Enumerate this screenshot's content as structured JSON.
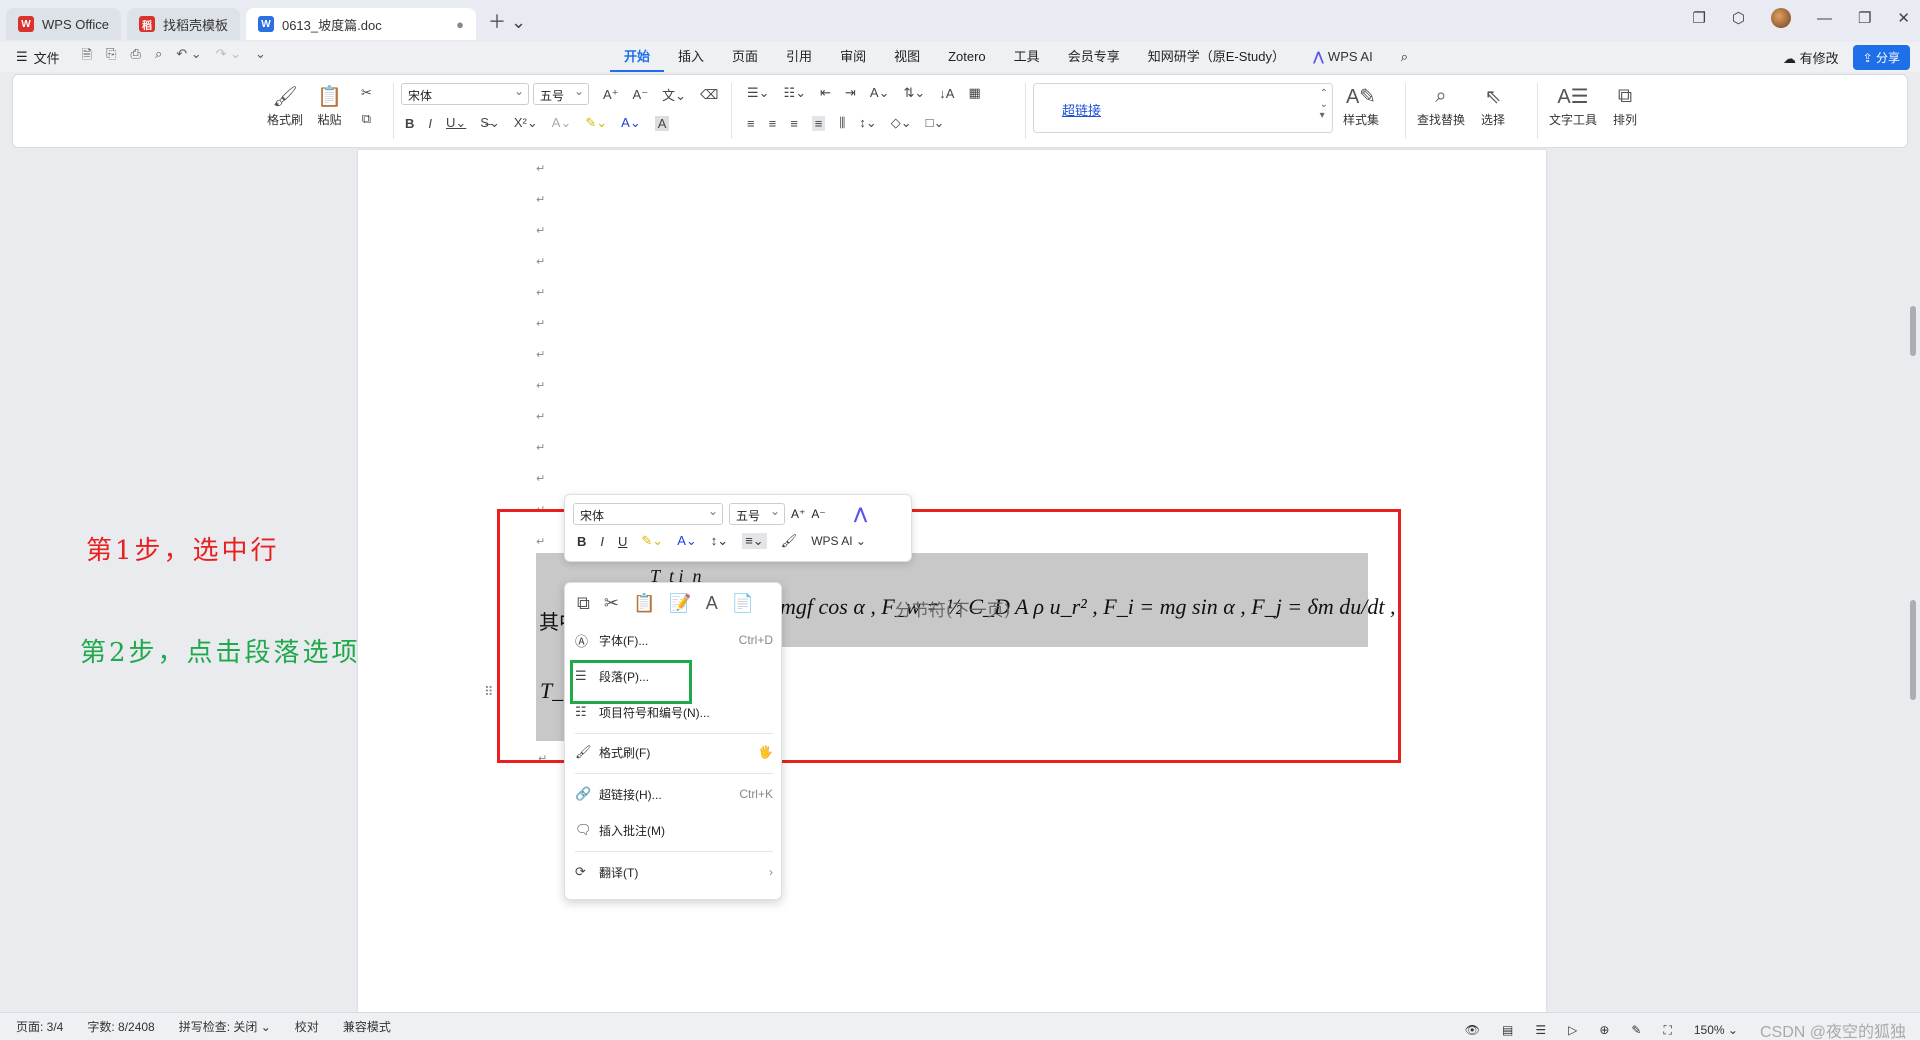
{
  "tabs": [
    {
      "label": "WPS Office",
      "color": "#d9322b"
    },
    {
      "label": "找稻壳模板",
      "color": "#d9322b"
    },
    {
      "label": "0613_坡度篇.doc",
      "color": "#2b6fe0"
    }
  ],
  "menubar": {
    "file_label": "文件",
    "menus": [
      "开始",
      "插入",
      "页面",
      "引用",
      "审阅",
      "视图",
      "Zotero",
      "工具",
      "会员专享",
      "知网研学（原E-Study）"
    ],
    "wps_ai": "WPS AI",
    "has_changes": "有修改",
    "share": "分享"
  },
  "ribbon": {
    "format_painter": "格式刷",
    "paste": "粘贴",
    "font_name": "宋体",
    "font_size": "五号",
    "style_link": "超链接",
    "style_set": "样式集",
    "find_replace": "查找替换",
    "select": "选择",
    "text_tools": "文字工具",
    "arrange": "排列"
  },
  "document": {
    "prefix_char": "其中",
    "Tt_label": "T_tq",
    "formula_fragment_top": "T_t i_n",
    "formula_main": "mgf cos α ,   F_w = ½ C_D A ρ u_r² ,   F_i = mg sin α ,   F_j = δm du/dt ,",
    "section_break": "分节符(下一页)"
  },
  "annotations": {
    "step1": "第1步，选中行",
    "step2": "第2步，点击段落选项"
  },
  "mini_toolbar": {
    "font": "宋体",
    "size": "五号",
    "wps_ai": "WPS AI"
  },
  "context_menu": {
    "items": [
      {
        "label": "字体(F)...",
        "shortcut": "Ctrl+D"
      },
      {
        "label": "段落(P)...",
        "shortcut": ""
      },
      {
        "label": "项目符号和编号(N)...",
        "shortcut": ""
      },
      {
        "label": "格式刷(F)",
        "shortcut": ""
      },
      {
        "label": "超链接(H)...",
        "shortcut": "Ctrl+K"
      },
      {
        "label": "插入批注(M)",
        "shortcut": ""
      },
      {
        "label": "翻译(T)",
        "shortcut": ""
      }
    ]
  },
  "statusbar": {
    "page": "页面: 3/4",
    "words": "字数: 8/2408",
    "spell": "拼写检查: 关闭",
    "proof": "校对",
    "compat": "兼容模式",
    "zoom": "150%",
    "watermark": "CSDN @夜空的狐独"
  }
}
